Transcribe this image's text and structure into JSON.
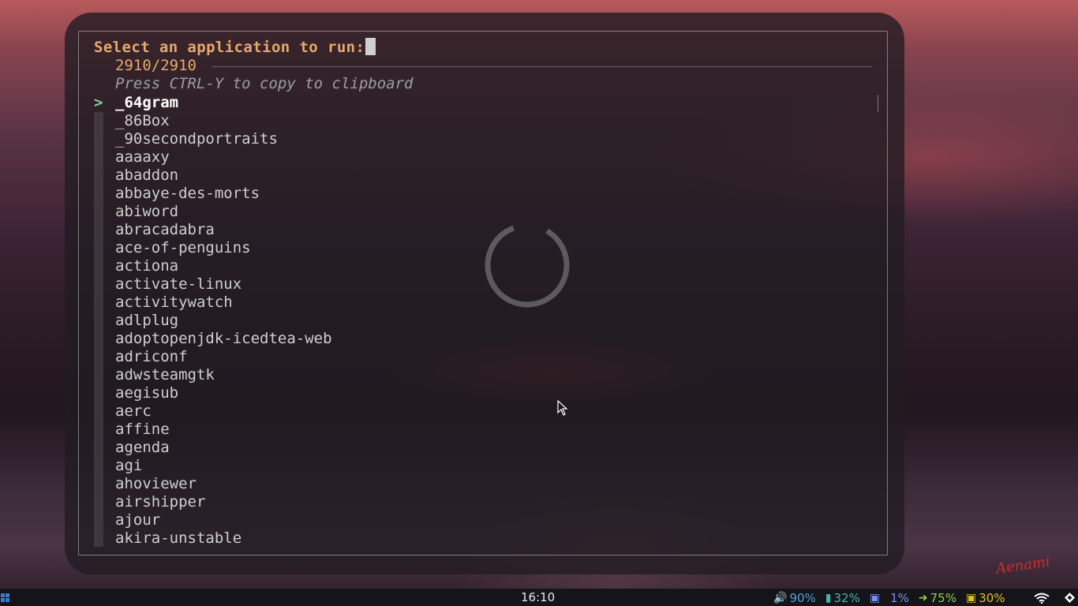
{
  "launcher": {
    "prompt": "Select an application to run:",
    "counter": "2910/2910",
    "hint": "Press CTRL-Y to copy to clipboard",
    "selected_marker": ">",
    "items": [
      "_64gram",
      "_86Box",
      "_90secondportraits",
      "aaaaxy",
      "abaddon",
      "abbaye-des-morts",
      "abiword",
      "abracadabra",
      "ace-of-penguins",
      "actiona",
      "activate-linux",
      "activitywatch",
      "adlplug",
      "adoptopenjdk-icedtea-web",
      "adriconf",
      "adwsteamgtk",
      "aegisub",
      "aerc",
      "affine",
      "agenda",
      "agi",
      "ahoviewer",
      "airshipper",
      "ajour",
      "akira-unstable"
    ],
    "selected_index": 0
  },
  "wallpaper": {
    "signature": "Aenami"
  },
  "taskbar": {
    "clock": "16:10",
    "volume": "90%",
    "memory": "32%",
    "cpu": "1%",
    "battery": "75%",
    "brightness": "30%"
  },
  "colors": {
    "prompt": "#e7a86d",
    "volume": "#4aa3e0",
    "memory": "#4ab0a8",
    "cpu": "#7c8ff0",
    "battery": "#8ccf4a",
    "brightness": "#e0c020"
  }
}
